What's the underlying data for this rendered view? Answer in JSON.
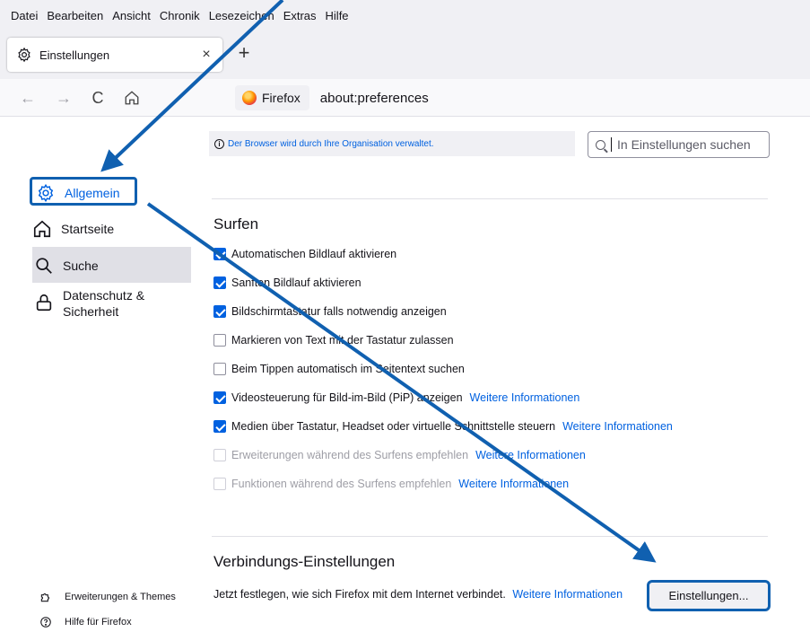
{
  "menu": [
    "Datei",
    "Bearbeiten",
    "Ansicht",
    "Chronik",
    "Lesezeichen",
    "Extras",
    "Hilfe"
  ],
  "tab": {
    "label": "Einstellungen",
    "close": "×",
    "new": "+"
  },
  "nav": {
    "back": "←",
    "forward": "→",
    "reload": "C",
    "home": "⌂"
  },
  "url": {
    "identity": "Firefox",
    "address": "about:preferences"
  },
  "managed_notice": "Der Browser wird durch Ihre Organisation verwaltet.",
  "search": {
    "placeholder": "In Einstellungen suchen"
  },
  "sidebar": {
    "items": [
      {
        "label": "Allgemein",
        "icon": "gear-icon"
      },
      {
        "label": "Startseite",
        "icon": "home-icon"
      },
      {
        "label": "Suche",
        "icon": "search-icon"
      },
      {
        "label": "Datenschutz & Sicherheit",
        "icon": "lock-icon"
      }
    ],
    "footer": [
      {
        "label": "Erweiterungen & Themes",
        "icon": "puzzle-icon"
      },
      {
        "label": "Hilfe für Firefox",
        "icon": "help-icon"
      }
    ]
  },
  "surfen": {
    "title": "Surfen",
    "options": [
      {
        "label": "Automatischen Bildlauf aktivieren",
        "checked": true,
        "disabled": false,
        "link": ""
      },
      {
        "label": "Sanften Bildlauf aktivieren",
        "checked": true,
        "disabled": false,
        "link": ""
      },
      {
        "label": "Bildschirmtastatur falls notwendig anzeigen",
        "checked": true,
        "disabled": false,
        "link": ""
      },
      {
        "label": "Markieren von Text mit der Tastatur zulassen",
        "checked": false,
        "disabled": false,
        "link": ""
      },
      {
        "label": "Beim Tippen automatisch im Seitentext suchen",
        "checked": false,
        "disabled": false,
        "link": ""
      },
      {
        "label": "Videosteuerung für Bild-im-Bild (PiP) anzeigen",
        "checked": true,
        "disabled": false,
        "link": "Weitere Informationen"
      },
      {
        "label": "Medien über Tastatur, Headset oder virtuelle Schnittstelle steuern",
        "checked": true,
        "disabled": false,
        "link": "Weitere Informationen"
      },
      {
        "label": "Erweiterungen während des Surfens empfehlen",
        "checked": false,
        "disabled": true,
        "link": "Weitere Informationen"
      },
      {
        "label": "Funktionen während des Surfens empfehlen",
        "checked": false,
        "disabled": true,
        "link": "Weitere Informationen"
      }
    ]
  },
  "connection": {
    "title": "Verbindungs-Einstellungen",
    "text": "Jetzt festlegen, wie sich Firefox mit dem Internet verbindet.",
    "link": "Weitere Informationen",
    "button": "Einstellungen..."
  },
  "colors": {
    "accent": "#0061e0",
    "annotation": "#1060b0"
  }
}
